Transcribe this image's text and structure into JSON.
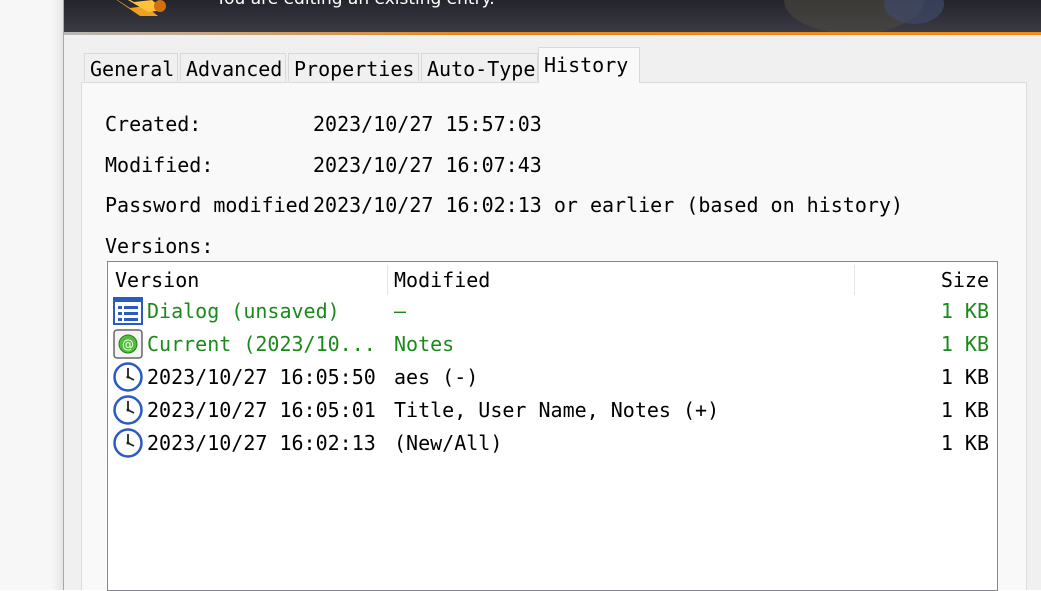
{
  "banner": {
    "text": "You are editing an existing entry."
  },
  "tabs": [
    {
      "label": "General",
      "active": false
    },
    {
      "label": "Advanced",
      "active": false
    },
    {
      "label": "Properties",
      "active": false
    },
    {
      "label": "Auto-Type",
      "active": false
    },
    {
      "label": "History",
      "active": true
    }
  ],
  "info": {
    "created_label": "Created:",
    "created_value": "2023/10/27 15:57:03",
    "modified_label": "Modified:",
    "modified_value": "2023/10/27 16:07:43",
    "password_label": "Password modified",
    "password_value": "2023/10/27 16:02:13 or earlier (based on history)",
    "versions_label": "Versions:"
  },
  "versions": {
    "columns": {
      "version": "Version",
      "modified": "Modified",
      "size": "Size"
    },
    "rows": [
      {
        "icon": "dialog-list-icon",
        "version": "Dialog (unsaved)",
        "modified": "—",
        "size": "1 KB",
        "highlight": true
      },
      {
        "icon": "current-entry-icon",
        "version": "Current (2023/10...",
        "modified": "Notes",
        "size": "1 KB",
        "highlight": true
      },
      {
        "icon": "clock-icon",
        "version": "2023/10/27 16:05:50",
        "modified": "aes (-)",
        "size": "1 KB",
        "highlight": false
      },
      {
        "icon": "clock-icon",
        "version": "2023/10/27 16:05:01",
        "modified": "Title, User Name, Notes (+)",
        "size": "1 KB",
        "highlight": false
      },
      {
        "icon": "clock-icon",
        "version": "2023/10/27 16:02:13",
        "modified": "(New/All)",
        "size": "1 KB",
        "highlight": false
      }
    ]
  },
  "colors": {
    "highlight_text": "#1a8a1a",
    "banner_bg": "#2a2a32",
    "banner_accent": "#f08c1c"
  }
}
